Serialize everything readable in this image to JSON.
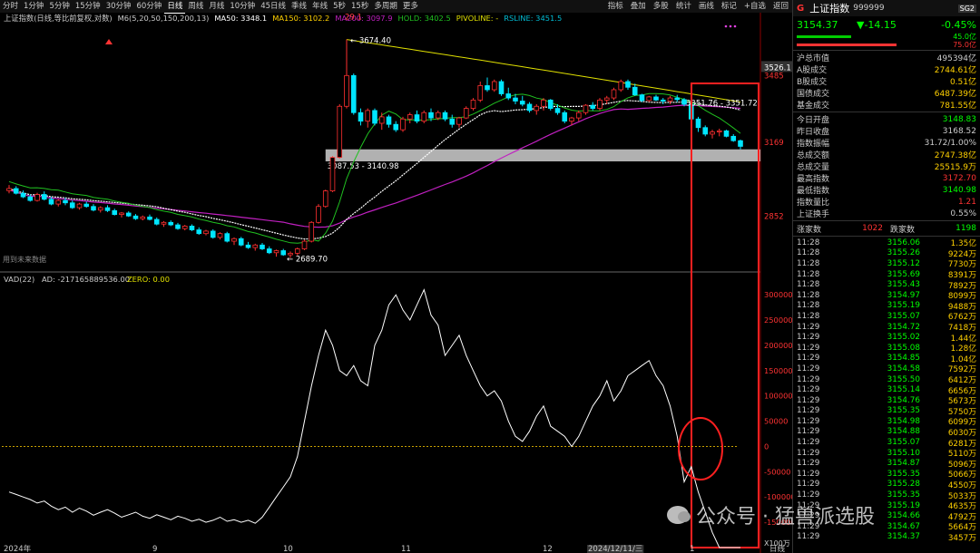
{
  "toolbar": {
    "periods": [
      "分时",
      "1分钟",
      "5分钟",
      "15分钟",
      "30分钟",
      "60分钟",
      "日线",
      "周线",
      "月线",
      "10分钟",
      "45日线",
      "季线",
      "年线",
      "5秒",
      "15秒",
      "多周期",
      "更多"
    ],
    "active_period": "日线",
    "right": [
      "指标",
      "叠加",
      "多股",
      "统计",
      "画线",
      "标记",
      "+自选",
      "返回"
    ]
  },
  "chart": {
    "info_name": "上证指数(日线,等比前复权,对数)",
    "info_m6": "M6(5,20,50,150,200,13)",
    "info_ma50": "MA50: 3348.1",
    "info_ma150": "MA150: 3102.2",
    "info_ma200": "MA200: 3097.9",
    "info_hold": "HOLD: 3402.5",
    "info_pivo": "PIVOLINE: -",
    "info_rs": "RSLINE: 3451.5",
    "top_label": "29.1",
    "high_label": "3674.40",
    "low_label": "2689.70",
    "box_label": "3087.53 - 3140.98",
    "range_label": "3351.76 - 3351.72",
    "nodata_label": "用到未来数据",
    "price_axis": [
      "3526.1",
      "3485",
      "3169",
      "2852"
    ],
    "sub_info_name": "VAD(22)",
    "sub_info_ad": "AD: -217165889536.00",
    "sub_info_zero": "ZERO: 0.00",
    "sub_axis": [
      "300000",
      "250000",
      "200000",
      "150000",
      "100000",
      "50000",
      "0",
      "-50000",
      "-100000",
      "-150000"
    ],
    "sub_unit": "X100万",
    "x_axis": [
      "2024年",
      "9",
      "10",
      "11",
      "12",
      "2024/12/11/三",
      "1"
    ],
    "period_label": "日线",
    "colors": {
      "up": "#ff3030",
      "down": "#00e5ff",
      "ma_yellow": "#e0e000",
      "ma_purple": "#c020c0",
      "ma_green": "#20c020",
      "ma_white": "#ffffff",
      "box": "#d0d0d0",
      "highlight": "#ff2020"
    }
  },
  "chart_data": {
    "type": "candlestick",
    "title": "上证指数 日线",
    "ylabel": "",
    "ylim": [
      2640,
      3720
    ],
    "candles": [
      [
        2961,
        2985,
        2950,
        2970
      ],
      [
        2970,
        2980,
        2945,
        2950
      ],
      [
        2950,
        2962,
        2930,
        2935
      ],
      [
        2935,
        2945,
        2915,
        2920
      ],
      [
        2920,
        2952,
        2915,
        2945
      ],
      [
        2945,
        2958,
        2920,
        2925
      ],
      [
        2925,
        2935,
        2900,
        2905
      ],
      [
        2905,
        2925,
        2895,
        2920
      ],
      [
        2920,
        2932,
        2900,
        2910
      ],
      [
        2910,
        2920,
        2885,
        2890
      ],
      [
        2890,
        2910,
        2882,
        2905
      ],
      [
        2905,
        2915,
        2890,
        2895
      ],
      [
        2895,
        2905,
        2875,
        2880
      ],
      [
        2880,
        2896,
        2870,
        2890
      ],
      [
        2890,
        2900,
        2872,
        2878
      ],
      [
        2878,
        2886,
        2858,
        2862
      ],
      [
        2862,
        2872,
        2850,
        2868
      ],
      [
        2868,
        2875,
        2852,
        2856
      ],
      [
        2856,
        2864,
        2840,
        2845
      ],
      [
        2845,
        2858,
        2838,
        2852
      ],
      [
        2852,
        2862,
        2838,
        2842
      ],
      [
        2842,
        2850,
        2818,
        2823
      ],
      [
        2823,
        2835,
        2812,
        2830
      ],
      [
        2830,
        2838,
        2815,
        2820
      ],
      [
        2820,
        2828,
        2800,
        2805
      ],
      [
        2805,
        2820,
        2798,
        2815
      ],
      [
        2815,
        2822,
        2795,
        2800
      ],
      [
        2800,
        2810,
        2780,
        2785
      ],
      [
        2785,
        2800,
        2778,
        2795
      ],
      [
        2795,
        2802,
        2765,
        2770
      ],
      [
        2770,
        2790,
        2762,
        2785
      ],
      [
        2785,
        2792,
        2750,
        2755
      ],
      [
        2755,
        2770,
        2740,
        2765
      ],
      [
        2765,
        2772,
        2735,
        2740
      ],
      [
        2740,
        2752,
        2725,
        2730
      ],
      [
        2730,
        2745,
        2718,
        2740
      ],
      [
        2740,
        2748,
        2720,
        2725
      ],
      [
        2725,
        2735,
        2705,
        2710
      ],
      [
        2710,
        2722,
        2695,
        2718
      ],
      [
        2718,
        2725,
        2698,
        2702
      ],
      [
        2702,
        2715,
        2689.7,
        2708
      ],
      [
        2708,
        2730,
        2700,
        2725
      ],
      [
        2725,
        2760,
        2720,
        2755
      ],
      [
        2755,
        2835,
        2750,
        2830
      ],
      [
        2830,
        2905,
        2825,
        2895
      ],
      [
        2895,
        2965,
        2890,
        2960
      ],
      [
        2960,
        3110,
        2955,
        3105
      ],
      [
        3105,
        3350,
        3100,
        3340
      ],
      [
        3340,
        3674.4,
        3330,
        3490
      ],
      [
        3490,
        3500,
        3300,
        3310
      ],
      [
        3310,
        3330,
        3250,
        3270
      ],
      [
        3270,
        3330,
        3240,
        3320
      ],
      [
        3320,
        3330,
        3250,
        3260
      ],
      [
        3260,
        3310,
        3230,
        3290
      ],
      [
        3290,
        3300,
        3240,
        3255
      ],
      [
        3255,
        3270,
        3220,
        3230
      ],
      [
        3230,
        3290,
        3220,
        3280
      ],
      [
        3280,
        3310,
        3260,
        3300
      ],
      [
        3300,
        3320,
        3260,
        3270
      ],
      [
        3270,
        3320,
        3260,
        3310
      ],
      [
        3310,
        3330,
        3270,
        3285
      ],
      [
        3285,
        3320,
        3275,
        3310
      ],
      [
        3310,
        3320,
        3270,
        3280
      ],
      [
        3280,
        3300,
        3240,
        3255
      ],
      [
        3255,
        3290,
        3240,
        3285
      ],
      [
        3285,
        3340,
        3280,
        3330
      ],
      [
        3330,
        3380,
        3320,
        3370
      ],
      [
        3370,
        3460,
        3360,
        3440
      ],
      [
        3440,
        3480,
        3410,
        3420
      ],
      [
        3420,
        3470,
        3410,
        3460
      ],
      [
        3460,
        3470,
        3390,
        3400
      ],
      [
        3400,
        3430,
        3370,
        3380
      ],
      [
        3380,
        3400,
        3350,
        3365
      ],
      [
        3365,
        3390,
        3340,
        3350
      ],
      [
        3350,
        3360,
        3310,
        3320
      ],
      [
        3320,
        3350,
        3300,
        3340
      ],
      [
        3340,
        3380,
        3320,
        3370
      ],
      [
        3370,
        3375,
        3320,
        3330
      ],
      [
        3330,
        3350,
        3300,
        3310
      ],
      [
        3310,
        3320,
        3260,
        3270
      ],
      [
        3270,
        3290,
        3250,
        3285
      ],
      [
        3285,
        3320,
        3270,
        3310
      ],
      [
        3310,
        3350,
        3300,
        3345
      ],
      [
        3345,
        3360,
        3320,
        3330
      ],
      [
        3330,
        3380,
        3320,
        3370
      ],
      [
        3370,
        3390,
        3350,
        3380
      ],
      [
        3380,
        3430,
        3370,
        3420
      ],
      [
        3420,
        3470,
        3410,
        3460
      ],
      [
        3460,
        3470,
        3420,
        3432
      ],
      [
        3432,
        3450,
        3390,
        3395
      ],
      [
        3395,
        3400,
        3360,
        3368
      ],
      [
        3368,
        3390,
        3360,
        3385
      ],
      [
        3385,
        3395,
        3365,
        3370
      ],
      [
        3370,
        3380,
        3350,
        3365
      ],
      [
        3365,
        3390,
        3350,
        3380
      ],
      [
        3380,
        3395,
        3360,
        3372
      ],
      [
        3372,
        3380,
        3340,
        3350
      ],
      [
        3350,
        3360,
        3270,
        3280
      ],
      [
        3280,
        3290,
        3220,
        3240
      ],
      [
        3240,
        3250,
        3200,
        3210
      ],
      [
        3210,
        3230,
        3190,
        3220
      ],
      [
        3220,
        3235,
        3200,
        3225
      ],
      [
        3225,
        3230,
        3195,
        3200
      ],
      [
        3200,
        3210,
        3175,
        3180
      ],
      [
        3180,
        3185,
        3140.98,
        3154.37
      ]
    ],
    "vad_range": [
      -200000,
      320000
    ],
    "vad": [
      -90000,
      -95000,
      -100000,
      -105000,
      -112000,
      -108000,
      -118000,
      -125000,
      -120000,
      -130000,
      -122000,
      -128000,
      -136000,
      -130000,
      -125000,
      -132000,
      -140000,
      -135000,
      -130000,
      -138000,
      -142000,
      -135000,
      -140000,
      -145000,
      -138000,
      -142000,
      -148000,
      -144000,
      -150000,
      -146000,
      -140000,
      -148000,
      -145000,
      -150000,
      -146000,
      -152000,
      -140000,
      -120000,
      -100000,
      -80000,
      -60000,
      -20000,
      50000,
      120000,
      180000,
      230000,
      200000,
      150000,
      140000,
      160000,
      130000,
      120000,
      200000,
      230000,
      280000,
      300000,
      270000,
      250000,
      280000,
      310000,
      260000,
      240000,
      180000,
      200000,
      220000,
      180000,
      150000,
      120000,
      100000,
      110000,
      90000,
      50000,
      20000,
      10000,
      30000,
      60000,
      80000,
      40000,
      30000,
      20000,
      0,
      20000,
      50000,
      80000,
      100000,
      130000,
      90000,
      110000,
      140000,
      150000,
      160000,
      170000,
      140000,
      120000,
      80000,
      20000,
      -70000,
      -40000,
      -90000,
      -130000,
      -170000,
      -200000,
      -200000,
      -200000,
      -200000
    ]
  },
  "right_panel": {
    "badge": "G",
    "name": "上证指数",
    "code": "999999",
    "level": "SG2",
    "price": "3154.37",
    "change": "▼-14.15",
    "pct": "-0.45%",
    "bar_up_pct": "45.0亿",
    "bar_down_pct": "75.0亿",
    "rows": [
      {
        "k": "沪总市值",
        "v": "495394亿",
        "c": "#ccc"
      },
      {
        "k": "A股成交",
        "v": "2744.61亿",
        "c": "#ffd000"
      },
      {
        "k": "B股成交",
        "v": "0.51亿",
        "c": "#ffd000"
      },
      {
        "k": "国债成交",
        "v": "6487.39亿",
        "c": "#ffd000"
      },
      {
        "k": "基金成交",
        "v": "781.55亿",
        "c": "#ffd000"
      }
    ],
    "rows2": [
      {
        "k": "今日开盘",
        "v": "3148.83",
        "c": "#0f0"
      },
      {
        "k": "昨日收盘",
        "v": "3168.52",
        "c": "#ccc"
      },
      {
        "k": "指数振幅",
        "v": "31.72/1.00%",
        "c": "#ccc"
      },
      {
        "k": "总成交额",
        "v": "2747.38亿",
        "c": "#ffd000"
      },
      {
        "k": "总成交量",
        "v": "25515.9万",
        "c": "#ffd000"
      },
      {
        "k": "最高指数",
        "v": "3172.70",
        "c": "#f33"
      },
      {
        "k": "最低指数",
        "v": "3140.98",
        "c": "#0f0"
      },
      {
        "k": "指数量比",
        "v": "1.21",
        "c": "#f33"
      },
      {
        "k": "上证换手",
        "v": "0.55%",
        "c": "#ccc"
      }
    ],
    "up_label": "涨家数",
    "up_count": "1022",
    "down_label": "跌家数",
    "down_count": "1198",
    "ticks": [
      [
        "11:28",
        "3156.06",
        "1.35亿",
        "#ffd000"
      ],
      [
        "11:28",
        "3155.26",
        "9224万",
        "#ffd000"
      ],
      [
        "11:28",
        "3155.12",
        "7730万",
        "#ffd000"
      ],
      [
        "11:28",
        "3155.69",
        "8391万",
        "#ffd000"
      ],
      [
        "11:28",
        "3155.43",
        "7892万",
        "#ffd000"
      ],
      [
        "11:28",
        "3154.97",
        "8099万",
        "#ffd000"
      ],
      [
        "11:28",
        "3155.19",
        "9488万",
        "#ffd000"
      ],
      [
        "11:28",
        "3155.07",
        "6762万",
        "#ffd000"
      ],
      [
        "11:29",
        "3154.72",
        "7418万",
        "#ffd000"
      ],
      [
        "11:29",
        "3155.02",
        "1.44亿",
        "#ffd000"
      ],
      [
        "11:29",
        "3155.08",
        "1.28亿",
        "#ffd000"
      ],
      [
        "11:29",
        "3154.85",
        "1.04亿",
        "#ffd000"
      ],
      [
        "11:29",
        "3154.58",
        "7592万",
        "#ffd000"
      ],
      [
        "11:29",
        "3155.50",
        "6412万",
        "#ffd000"
      ],
      [
        "11:29",
        "3155.14",
        "6656万",
        "#ffd000"
      ],
      [
        "11:29",
        "3154.76",
        "5673万",
        "#ffd000"
      ],
      [
        "11:29",
        "3155.35",
        "5750万",
        "#ffd000"
      ],
      [
        "11:29",
        "3154.98",
        "6099万",
        "#ffd000"
      ],
      [
        "11:29",
        "3154.88",
        "6030万",
        "#ffd000"
      ],
      [
        "11:29",
        "3155.07",
        "6281万",
        "#ffd000"
      ],
      [
        "11:29",
        "3155.10",
        "5110万",
        "#ffd000"
      ],
      [
        "11:29",
        "3154.87",
        "5096万",
        "#ffd000"
      ],
      [
        "11:29",
        "3155.35",
        "5066万",
        "#ffd000"
      ],
      [
        "11:29",
        "3155.28",
        "4550万",
        "#ffd000"
      ],
      [
        "11:29",
        "3155.35",
        "5033万",
        "#ffd000"
      ],
      [
        "11:29",
        "3155.19",
        "4635万",
        "#ffd000"
      ],
      [
        "11:29",
        "3154.66",
        "4792万",
        "#ffd000"
      ],
      [
        "11:29",
        "3154.67",
        "5664万",
        "#ffd000"
      ],
      [
        "11:29",
        "3154.37",
        "3457万",
        "#ffd000"
      ]
    ]
  },
  "watermark": "公众号 · 猛兽派选股"
}
